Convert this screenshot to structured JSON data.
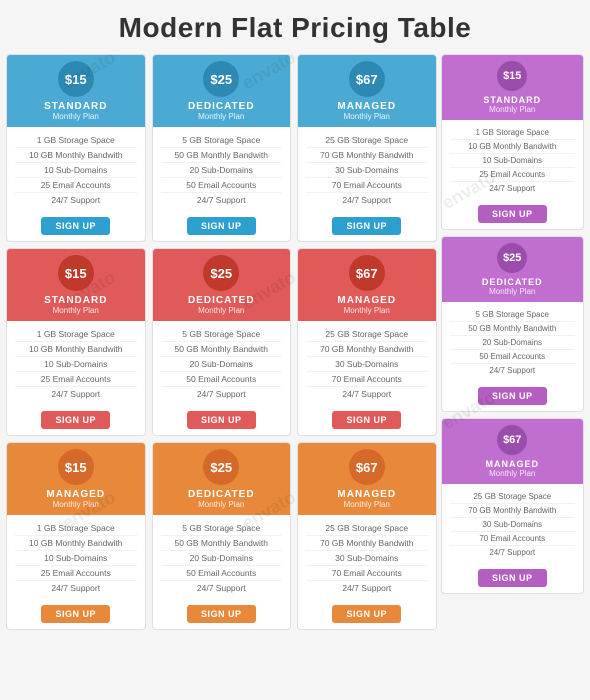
{
  "title": "Modern Flat Pricing Table",
  "watermark_text": "envato",
  "rows": [
    {
      "theme": "blue",
      "cards": [
        {
          "price": "$15",
          "name": "STANDARD",
          "sub": "Monthly Plan",
          "features": [
            "1 GB Storage Space",
            "10 GB Monthly Bandwith",
            "10 Sub-Domains",
            "25 Email Accounts",
            "24/7 Support"
          ],
          "btn": "Sign Up"
        },
        {
          "price": "$25",
          "name": "DEDICATED",
          "sub": "Monthly Plan",
          "features": [
            "5 GB Storage Space",
            "50 GB Monthly Bandwith",
            "20 Sub-Domains",
            "50 Email Accounts",
            "24/7 Support"
          ],
          "btn": "Sign Up"
        },
        {
          "price": "$67",
          "name": "MANAGED",
          "sub": "Monthly Plan",
          "features": [
            "25 GB Storage Space",
            "70 GB Monthly Bandwith",
            "30 Sub-Domains",
            "70 Email Accounts",
            "24/7 Support"
          ],
          "btn": "Sign Up"
        }
      ]
    },
    {
      "theme": "red",
      "cards": [
        {
          "price": "$15",
          "name": "STANDARD",
          "sub": "Monthly Plan",
          "features": [
            "1 GB Storage Space",
            "10 GB Monthly Bandwith",
            "10 Sub-Domains",
            "25 Email Accounts",
            "24/7 Support"
          ],
          "btn": "Sign Up"
        },
        {
          "price": "$25",
          "name": "DEDICATED",
          "sub": "Monthly Plan",
          "features": [
            "5 GB Storage Space",
            "50 GB Monthly Bandwith",
            "20 Sub-Domains",
            "50 Email Accounts",
            "24/7 Support"
          ],
          "btn": "Sign Up"
        },
        {
          "price": "$67",
          "name": "MANAGED",
          "sub": "Monthly Plan",
          "features": [
            "25 GB Storage Space",
            "70 GB Monthly Bandwith",
            "30 Sub-Domains",
            "70 Email Accounts",
            "24/7 Support"
          ],
          "btn": "Sign Up"
        }
      ]
    },
    {
      "theme": "orange",
      "cards": [
        {
          "price": "$15",
          "name": "MANAGED",
          "sub": "Monthly Plan",
          "features": [
            "1 GB Storage Space",
            "10 GB Monthly Bandwith",
            "10 Sub-Domains",
            "25 Email Accounts",
            "24/7 Support"
          ],
          "btn": "Sign Up"
        },
        {
          "price": "$25",
          "name": "DEDICATED",
          "sub": "Monthly Plan",
          "features": [
            "5 GB Storage Space",
            "50 GB Monthly Bandwith",
            "20 Sub-Domains",
            "50 Email Accounts",
            "24/7 Support"
          ],
          "btn": "Sign Up"
        },
        {
          "price": "$67",
          "name": "MANAGED",
          "sub": "Monthly Plan",
          "features": [
            "25 GB Storage Space",
            "70 GB Monthly Bandwith",
            "30 Sub-Domains",
            "70 Email Accounts",
            "24/7 Support"
          ],
          "btn": "Sign Up"
        }
      ]
    }
  ],
  "right_column": [
    {
      "price": "$15",
      "name": "STANDARD",
      "sub": "Monthly Plan",
      "features": [
        "1 GB Storage Space",
        "10 GB Monthly Bandwith",
        "10 Sub-Domains",
        "25 Email Accounts",
        "24/7 Support"
      ],
      "btn": "Sign Up"
    },
    {
      "price": "$25",
      "name": "DEDICATED",
      "sub": "Monthly Plan",
      "features": [
        "5 GB Storage Space",
        "50 GB Monthly Bandwith",
        "20 Sub-Domains",
        "50 Email Accounts",
        "24/7 Support"
      ],
      "btn": "Sign Up"
    },
    {
      "price": "$67",
      "name": "MANAGED",
      "sub": "Monthly Plan",
      "features": [
        "25 GB Storage Space",
        "70 GB Monthly Bandwith",
        "30 Sub-Domains",
        "70 Email Accounts",
        "24/7 Support"
      ],
      "btn": "Sign Up"
    }
  ],
  "colors": {
    "blue_header": "#4baad3",
    "blue_circle": "#2d89b4",
    "blue_btn": "#2da0d0",
    "red_header": "#e05a5a",
    "red_circle": "#c0392b",
    "orange_header": "#e8883a",
    "orange_circle": "#d4692a",
    "purple_header": "#c06ecf",
    "purple_circle": "#9b4dab"
  }
}
